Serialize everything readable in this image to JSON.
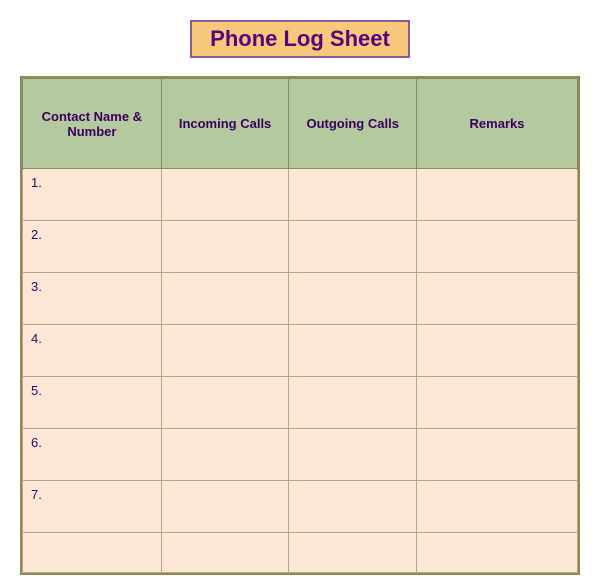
{
  "title": "Phone Log Sheet",
  "table": {
    "headers": [
      "Contact Name & Number",
      "Incoming Calls",
      "Outgoing Calls",
      "Remarks"
    ],
    "rows": [
      {
        "index": "1.",
        "incoming": "",
        "outgoing": "",
        "remarks": ""
      },
      {
        "index": "2.",
        "incoming": "",
        "outgoing": "",
        "remarks": ""
      },
      {
        "index": "3.",
        "incoming": "",
        "outgoing": "",
        "remarks": ""
      },
      {
        "index": "4.",
        "incoming": "",
        "outgoing": "",
        "remarks": ""
      },
      {
        "index": "5.",
        "incoming": "",
        "outgoing": "",
        "remarks": ""
      },
      {
        "index": "6.",
        "incoming": "",
        "outgoing": "",
        "remarks": ""
      },
      {
        "index": "7.",
        "incoming": "",
        "outgoing": "",
        "remarks": ""
      },
      {
        "index": "",
        "incoming": "",
        "outgoing": "",
        "remarks": ""
      }
    ]
  }
}
